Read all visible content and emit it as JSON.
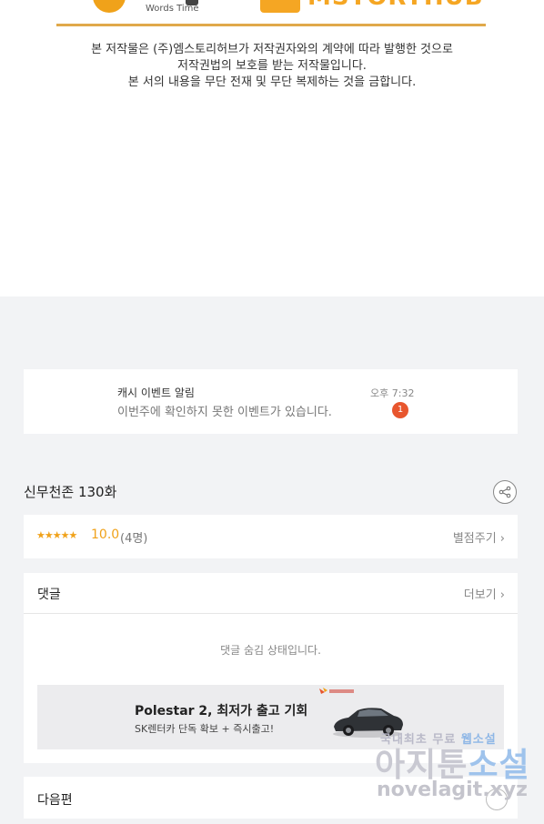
{
  "copyright": {
    "logo_left_text": "Words Time",
    "logo_right_text": "MSTORYHUB",
    "lines": [
      "본 저작물은 (주)엠스토리허브가 저작권자와의 계약에 따라 발행한 것으로",
      "저작권법의 보호를 받는 저작물입니다.",
      "본 서의 내용을 무단 전재 및 무단 복제하는 것을 금합니다."
    ]
  },
  "notification": {
    "title": "캐시 이벤트 알림",
    "message": "이번주에 확인하지 못한 이벤트가 있습니다.",
    "time": "오후 7:32",
    "badge": "1"
  },
  "episode": {
    "title": "신무천존 130화",
    "share_icon": "share-icon"
  },
  "rating": {
    "stars": "★★★★★",
    "score": "10.0",
    "count": "(4명)",
    "rate_link": "별점주기 ›"
  },
  "comments": {
    "header": "댓글",
    "more": "더보기 ›",
    "hidden_notice": "댓글 숨김 상태입니다."
  },
  "ad": {
    "brand": "SK렌터카",
    "title": "Polestar 2, 최저가 출고 기회",
    "subtitle": "SK렌터카 단독 확보 + 즉시출고!"
  },
  "next": {
    "label": "다음편"
  },
  "watermark": {
    "line1_prefix": "국내최초 무료 ",
    "line1_highlight": "웹소설",
    "line2_prefix": "아지툰",
    "line2_highlight": "소설",
    "line3": "novelagit.xyz"
  },
  "colors": {
    "accent": "#f0a21a",
    "badge": "#e8562e",
    "page_bg": "#f2f3f5"
  }
}
